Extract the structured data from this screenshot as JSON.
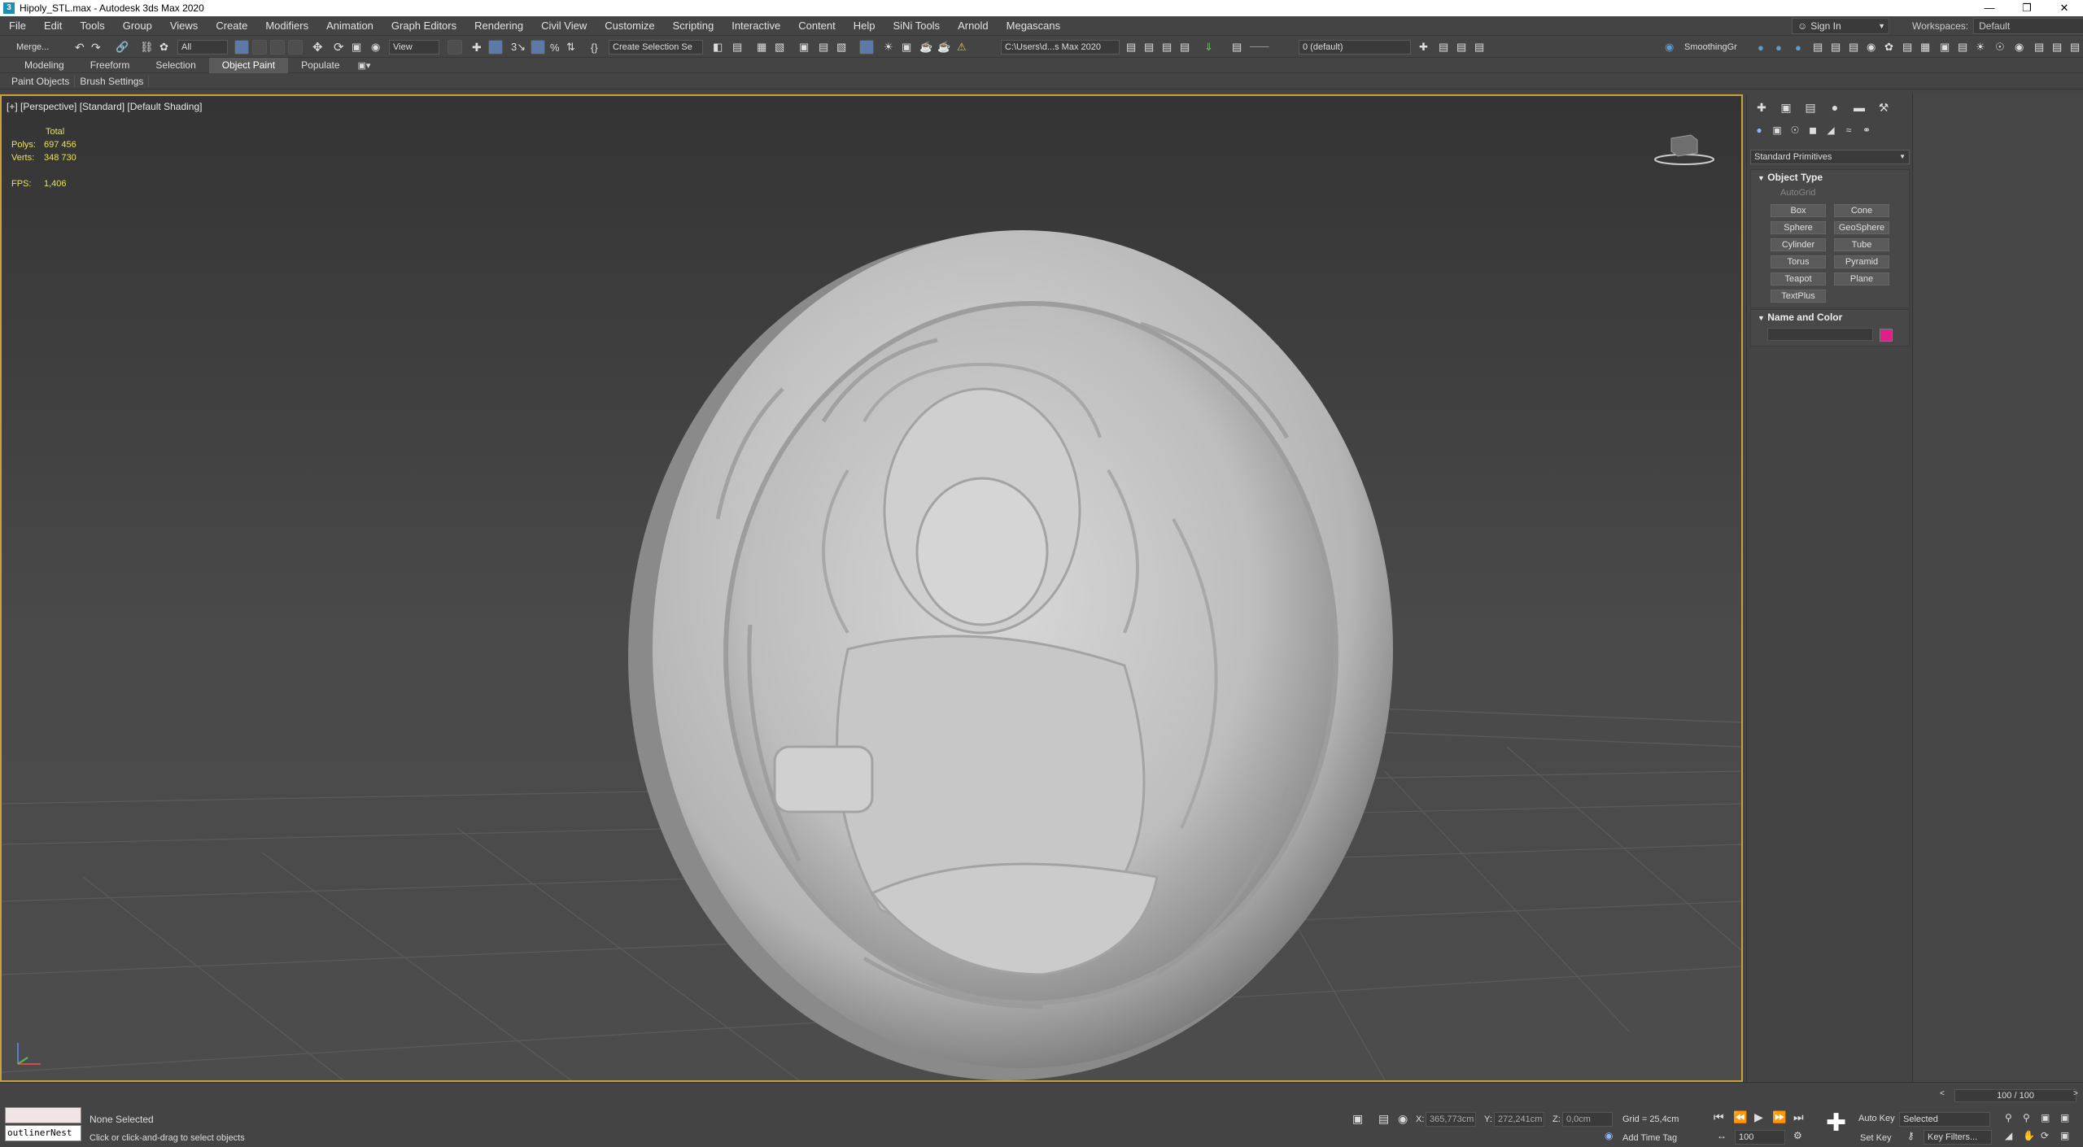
{
  "window": {
    "title": "Hipoly_STL.max - Autodesk 3ds Max 2020",
    "app_icon": "3"
  },
  "menu": [
    "File",
    "Edit",
    "Tools",
    "Group",
    "Views",
    "Create",
    "Modifiers",
    "Animation",
    "Graph Editors",
    "Rendering",
    "Civil View",
    "Customize",
    "Scripting",
    "Interactive",
    "Content",
    "Help",
    "SiNi Tools",
    "Arnold",
    "Megascans"
  ],
  "account": {
    "sign_in": "Sign In",
    "workspaces_label": "Workspaces:",
    "workspace": "Default"
  },
  "toolbar": {
    "merge": "Merge...",
    "selection_filter": "All",
    "ref_coord": "View",
    "selection_set": "Create Selection Se",
    "project_path": "C:\\Users\\d...s Max 2020",
    "layer": "0 (default)",
    "smoothing": "SmoothingGr"
  },
  "ribbon": {
    "tabs": [
      "Modeling",
      "Freeform",
      "Selection",
      "Object Paint",
      "Populate"
    ],
    "active": "Object Paint",
    "sub": [
      "Paint Objects",
      "Brush Settings"
    ]
  },
  "viewport": {
    "label": "[+] [Perspective] [Standard] [Default Shading]",
    "stats": {
      "total_label": "Total",
      "polys_label": "Polys:",
      "polys": "697 456",
      "verts_label": "Verts:",
      "verts": "348 730",
      "fps_label": "FPS:",
      "fps": "1,406"
    }
  },
  "command_panel": {
    "category": "Standard Primitives",
    "object_type": {
      "title": "Object Type",
      "autogrid": "AutoGrid",
      "buttons": [
        "Box",
        "Cone",
        "Sphere",
        "GeoSphere",
        "Cylinder",
        "Tube",
        "Torus",
        "Pyramid",
        "Teapot",
        "Plane",
        "TextPlus"
      ]
    },
    "name_color": {
      "title": "Name and Color",
      "color": "#e0208a"
    }
  },
  "status": {
    "selection": "None Selected",
    "prompt": "Click or click-and-drag to select objects",
    "maxscript": "outlinerNest",
    "x_label": "X:",
    "x": "365,773cm",
    "y_label": "Y:",
    "y": "272,241cm",
    "z_label": "Z:",
    "z": "0,0cm",
    "grid": "Grid = 25,4cm",
    "add_time_tag": "Add Time Tag",
    "time_slider": "100 / 100",
    "frame": "100",
    "auto_key": "Auto Key",
    "set_key": "Set Key",
    "key_mode": "Selected",
    "key_filters": "Key Filters..."
  }
}
